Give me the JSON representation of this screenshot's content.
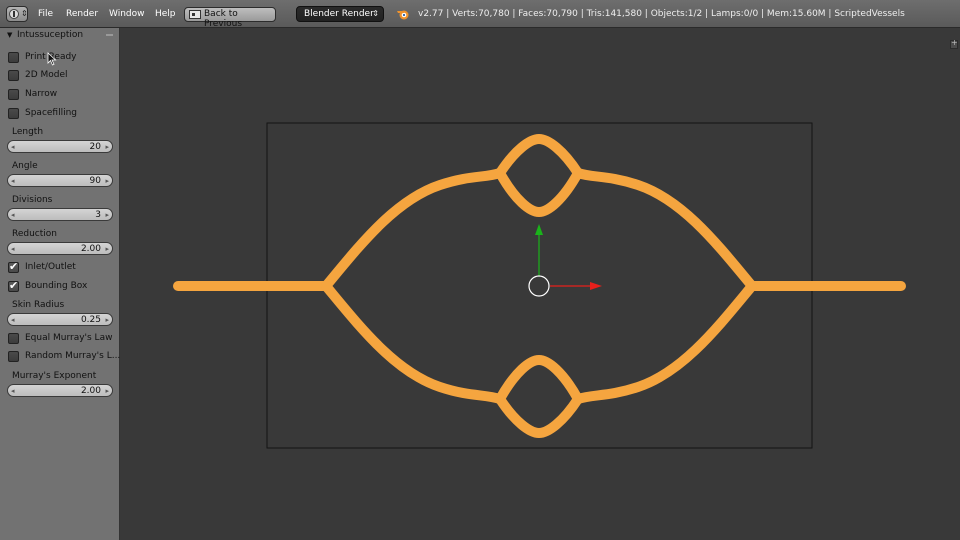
{
  "header": {
    "menus": [
      "File",
      "Render",
      "Window",
      "Help"
    ],
    "back_label": "Back to Previous",
    "render_engine": "Blender Render",
    "stats": "v2.77 | Verts:70,780 | Faces:70,790 | Tris:141,580 | Objects:1/2 | Lamps:0/0 | Mem:15.60M | ScriptedVessels"
  },
  "panel": {
    "title": "Intussuception",
    "checkboxes_top": [
      {
        "label": "Print Ready",
        "checked": false
      },
      {
        "label": "2D Model",
        "checked": false
      },
      {
        "label": "Narrow",
        "checked": false
      },
      {
        "label": "Spacefilling",
        "checked": false
      }
    ],
    "length": {
      "label": "Length",
      "value": "20"
    },
    "angle": {
      "label": "Angle",
      "value": "90"
    },
    "divisions": {
      "label": "Divisions",
      "value": "3"
    },
    "reduction": {
      "label": "Reduction",
      "value": "2.00"
    },
    "inlet_outlet": {
      "label": "Inlet/Outlet",
      "checked": true
    },
    "bounding_box": {
      "label": "Bounding Box",
      "checked": true
    },
    "skin_radius": {
      "label": "Skin Radius",
      "value": "0.25"
    },
    "equal_murray": {
      "label": "Equal Murray's Law",
      "checked": false
    },
    "random_murray": {
      "label": "Random Murray's L...",
      "checked": false
    },
    "murray_exponent": {
      "label": "Murray's Exponent",
      "value": "2.00"
    }
  },
  "icons": {
    "editor_type": "info-editor-icon",
    "back": "screen-back-icon",
    "logo": "blender-logo-icon"
  },
  "colors": {
    "vessel": "#f5a53f",
    "viewport_bg": "#393939",
    "axis_x": "#e8201c",
    "axis_y": "#1ab41a"
  }
}
